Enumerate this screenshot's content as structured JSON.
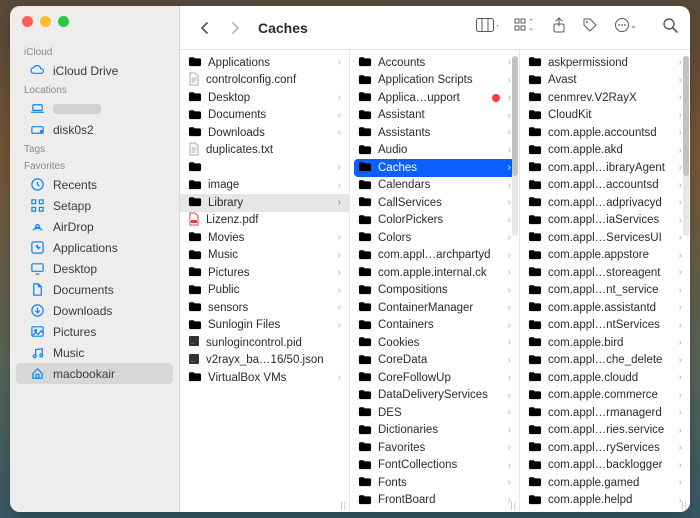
{
  "window": {
    "title": "Caches"
  },
  "sidebar": {
    "sections": [
      {
        "label": "iCloud",
        "items": [
          {
            "label": "iCloud Drive",
            "icon": "cloud"
          }
        ]
      },
      {
        "label": "Locations",
        "items": [
          {
            "label": "",
            "icon": "laptop",
            "hidden": true
          },
          {
            "label": "disk0s2",
            "icon": "disk"
          }
        ]
      },
      {
        "label": "Tags",
        "items": []
      },
      {
        "label": "Favorites",
        "items": [
          {
            "label": "Recents",
            "icon": "clock"
          },
          {
            "label": "Setapp",
            "icon": "grid"
          },
          {
            "label": "AirDrop",
            "icon": "airdrop"
          },
          {
            "label": "Applications",
            "icon": "apps"
          },
          {
            "label": "Desktop",
            "icon": "desktop"
          },
          {
            "label": "Documents",
            "icon": "doc"
          },
          {
            "label": "Downloads",
            "icon": "down"
          },
          {
            "label": "Pictures",
            "icon": "pic"
          },
          {
            "label": "Music",
            "icon": "music"
          },
          {
            "label": "macbookair",
            "icon": "home",
            "selected": true
          }
        ]
      }
    ]
  },
  "columns": [
    {
      "selected_index": 8,
      "items": [
        {
          "label": "Applications",
          "type": "folder",
          "has_children": true
        },
        {
          "label": "controlconfig.conf",
          "type": "file-text"
        },
        {
          "label": "Desktop",
          "type": "folder",
          "has_children": true
        },
        {
          "label": "Documents",
          "type": "folder",
          "has_children": true
        },
        {
          "label": "Downloads",
          "type": "folder",
          "has_children": true
        },
        {
          "label": "duplicates.txt",
          "type": "file-text"
        },
        {
          "label": "",
          "type": "folder",
          "hidden": true,
          "has_children": true
        },
        {
          "label": "image",
          "type": "folder",
          "has_children": true
        },
        {
          "label": "Library",
          "type": "folder",
          "has_children": true,
          "selected": "gray"
        },
        {
          "label": "Lizenz.pdf",
          "type": "file-pdf"
        },
        {
          "label": "Movies",
          "type": "folder",
          "has_children": true
        },
        {
          "label": "Music",
          "type": "folder",
          "has_children": true
        },
        {
          "label": "Pictures",
          "type": "folder",
          "has_children": true
        },
        {
          "label": "Public",
          "type": "folder",
          "has_children": true
        },
        {
          "label": "sensors",
          "type": "folder",
          "has_children": true
        },
        {
          "label": "Sunlogin Files",
          "type": "folder",
          "has_children": true
        },
        {
          "label": "sunlogincontrol.pid",
          "type": "file-exec"
        },
        {
          "label": "v2rayx_ba…16/50.json",
          "type": "file-exec"
        },
        {
          "label": "VirtualBox VMs",
          "type": "folder",
          "has_children": true
        }
      ]
    },
    {
      "selected_index": 6,
      "items": [
        {
          "label": "Accounts",
          "type": "folder",
          "has_children": true
        },
        {
          "label": "Application Scripts",
          "type": "folder",
          "has_children": true
        },
        {
          "label": "Applica…upport",
          "type": "folder",
          "has_children": true,
          "tagged": "red"
        },
        {
          "label": "Assistant",
          "type": "folder",
          "has_children": true
        },
        {
          "label": "Assistants",
          "type": "folder",
          "has_children": true
        },
        {
          "label": "Audio",
          "type": "folder",
          "has_children": true
        },
        {
          "label": "Caches",
          "type": "folder",
          "has_children": true,
          "selected": "blue"
        },
        {
          "label": "Calendars",
          "type": "folder",
          "has_children": true
        },
        {
          "label": "CallServices",
          "type": "folder",
          "has_children": true
        },
        {
          "label": "ColorPickers",
          "type": "folder",
          "has_children": true
        },
        {
          "label": "Colors",
          "type": "folder",
          "has_children": true
        },
        {
          "label": "com.appl…archpartyd",
          "type": "folder",
          "has_children": true
        },
        {
          "label": "com.apple.internal.ck",
          "type": "folder",
          "has_children": true
        },
        {
          "label": "Compositions",
          "type": "folder",
          "has_children": true
        },
        {
          "label": "ContainerManager",
          "type": "folder",
          "has_children": true
        },
        {
          "label": "Containers",
          "type": "folder",
          "has_children": true
        },
        {
          "label": "Cookies",
          "type": "folder",
          "has_children": true
        },
        {
          "label": "CoreData",
          "type": "folder",
          "has_children": true
        },
        {
          "label": "CoreFollowUp",
          "type": "folder",
          "has_children": true
        },
        {
          "label": "DataDeliveryServices",
          "type": "folder",
          "has_children": true
        },
        {
          "label": "DES",
          "type": "folder",
          "has_children": true
        },
        {
          "label": "Dictionaries",
          "type": "folder",
          "has_children": true
        },
        {
          "label": "Favorites",
          "type": "folder",
          "has_children": true
        },
        {
          "label": "FontCollections",
          "type": "folder",
          "has_children": true
        },
        {
          "label": "Fonts",
          "type": "folder",
          "has_children": true
        },
        {
          "label": "FrontBoard",
          "type": "folder",
          "has_children": true
        }
      ]
    },
    {
      "items": [
        {
          "label": "askpermissiond",
          "type": "folder",
          "has_children": true
        },
        {
          "label": "Avast",
          "type": "folder",
          "has_children": true
        },
        {
          "label": "cenmrev.V2RayX",
          "type": "folder",
          "has_children": true
        },
        {
          "label": "CloudKit",
          "type": "folder",
          "has_children": true
        },
        {
          "label": "com.apple.accountsd",
          "type": "folder",
          "has_children": true
        },
        {
          "label": "com.apple.akd",
          "type": "folder",
          "has_children": true
        },
        {
          "label": "com.appl…ibraryAgent",
          "type": "folder",
          "has_children": true
        },
        {
          "label": "com.appl…accountsd",
          "type": "folder",
          "has_children": true
        },
        {
          "label": "com.appl…adprivacyd",
          "type": "folder",
          "has_children": true
        },
        {
          "label": "com.appl…iaServices",
          "type": "folder",
          "has_children": true
        },
        {
          "label": "com.appl…ServicesUI",
          "type": "folder",
          "has_children": true
        },
        {
          "label": "com.apple.appstore",
          "type": "folder",
          "has_children": true
        },
        {
          "label": "com.appl…storeagent",
          "type": "folder",
          "has_children": true
        },
        {
          "label": "com.appl…nt_service",
          "type": "folder",
          "has_children": true
        },
        {
          "label": "com.apple.assistantd",
          "type": "folder",
          "has_children": true
        },
        {
          "label": "com.appl…ntServices",
          "type": "folder",
          "has_children": true
        },
        {
          "label": "com.apple.bird",
          "type": "folder",
          "has_children": true
        },
        {
          "label": "com.appl…che_delete",
          "type": "folder",
          "has_children": true
        },
        {
          "label": "com.apple.cloudd",
          "type": "folder",
          "has_children": true
        },
        {
          "label": "com.apple.commerce",
          "type": "folder",
          "has_children": true
        },
        {
          "label": "com.appl…rmanagerd",
          "type": "folder",
          "has_children": true
        },
        {
          "label": "com.appl…ries.service",
          "type": "folder",
          "has_children": true
        },
        {
          "label": "com.appl…ryServices",
          "type": "folder",
          "has_children": true
        },
        {
          "label": "com.appl…backlogger",
          "type": "folder",
          "has_children": true
        },
        {
          "label": "com.apple.gamed",
          "type": "folder",
          "has_children": true
        },
        {
          "label": "com.apple.helpd",
          "type": "folder",
          "has_children": true
        }
      ]
    }
  ]
}
